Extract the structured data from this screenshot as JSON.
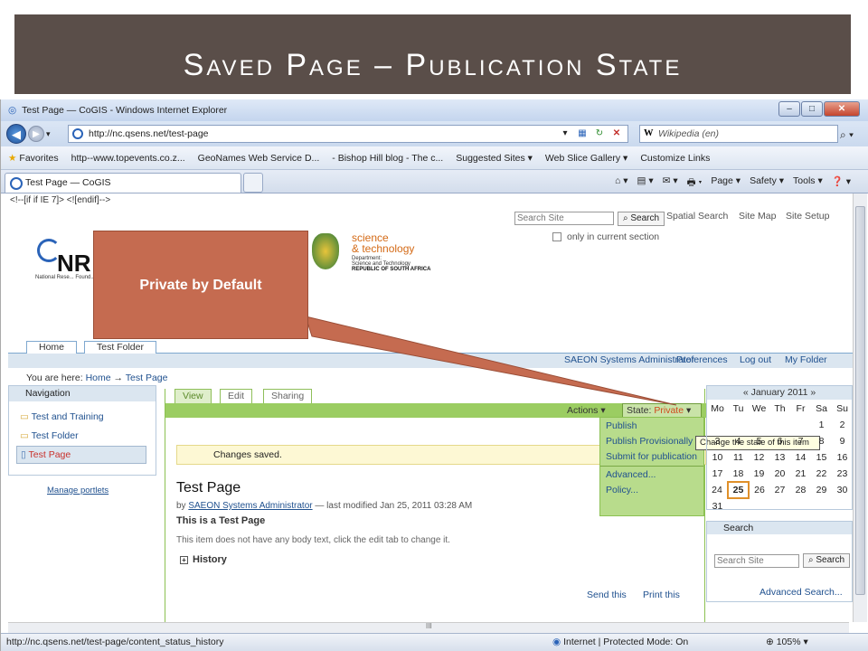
{
  "slide_title": "Saved Page – Publication State",
  "callout_text": "Private by Default",
  "browser": {
    "window_title": "Test Page — CoGIS - Windows Internet Explorer",
    "window_buttons": [
      "–",
      "□",
      "✕"
    ],
    "back_icon": "back-arrow-icon",
    "address": "http://nc.qsens.net/test-page",
    "search_engine_placeholder": "Wikipedia (en)",
    "search_engine_letter": "W",
    "favorites": [
      "Favorites",
      "http--www.topevents.co.z...",
      "GeoNames Web Service D...",
      "- Bishop Hill blog - The c...",
      "Suggested Sites ▾",
      "Web Slice Gallery ▾",
      "Customize Links"
    ],
    "tab_label": "Test Page — CoGIS",
    "commands": [
      "⌂ ▾",
      "▤ ▾",
      "✉ ▾",
      "🖶 ▾",
      "Page ▾",
      "Safety ▾",
      "Tools ▾",
      "❓ ▾"
    ],
    "status_url": "http://nc.qsens.net/test-page/content_status_history",
    "zone": "Internet | Protected Mode: On",
    "zoom": "105%",
    "hscroll_grip": "III"
  },
  "site": {
    "ie_comment": "<!--[if if IE 7]> <![endif]-->",
    "search_placeholder": "Search Site",
    "search_button": "Search",
    "top_links": [
      "Spatial Search",
      "Site Map",
      "Site Setup"
    ],
    "only_section": "only in current section",
    "logo_nrf_text": "NR",
    "logo_nrf_sub": "National Rese... Found...",
    "dst_logo_line1": "science",
    "dst_logo_line2": "& technology",
    "dst_logo_dept": "Department:",
    "dst_logo_dept2": "Science and Technology",
    "dst_logo_country": "REPUBLIC OF SOUTH AFRICA",
    "portal_tabs": [
      "Home",
      "Test Folder"
    ],
    "user_links": [
      "SAEON Systems Administrator",
      "Preferences",
      "Log out",
      "My Folder"
    ],
    "breadcrumb_prefix": "You are here:",
    "breadcrumb": [
      "Home",
      "→",
      "Test Page"
    ],
    "navigation_title": "Navigation",
    "nav_items": [
      "Test and Training",
      "Test Folder",
      "Test Page"
    ],
    "manage_portlets": "Manage portlets",
    "content_tabs": [
      "View",
      "Edit",
      "Sharing"
    ],
    "actions_label": "Actions ▾",
    "state_label": "State:",
    "state_value": "Private",
    "state_menu": [
      "Publish",
      "Publish Provisionally",
      "Submit for publication",
      "Advanced...",
      "Policy..."
    ],
    "tooltip": "Change the state of this item",
    "status_message": "Changes saved.",
    "page_heading": "Test Page",
    "byline_prefix": "by",
    "byline_author": "SAEON Systems Administrator",
    "byline_suffix": "— last modified Jan 25, 2011 03:28 AM",
    "description": "This is a Test Page",
    "no_body_text": "This item does not have any body text, click the edit tab to change it.",
    "history_label": "History",
    "footer_links": [
      "Send this",
      "Print this"
    ],
    "calendar_title": "« January 2011 »",
    "calendar_days": [
      "Mo",
      "Tu",
      "We",
      "Th",
      "Fr",
      "Sa",
      "Su"
    ],
    "calendar_weeks": [
      [
        "",
        "",
        "",
        "",
        "",
        "1",
        "2"
      ],
      [
        "3",
        "4",
        "5",
        "6",
        "7",
        "8",
        "9"
      ],
      [
        "10",
        "11",
        "12",
        "13",
        "14",
        "15",
        "16"
      ],
      [
        "17",
        "18",
        "19",
        "20",
        "21",
        "22",
        "23"
      ],
      [
        "24",
        "25",
        "26",
        "27",
        "28",
        "29",
        "30"
      ],
      [
        "31",
        "",
        "",
        "",
        "",
        "",
        ""
      ]
    ],
    "calendar_today": "25",
    "search_portlet_title": "Search",
    "search_portlet_placeholder": "Search Site",
    "search_portlet_button": "Search",
    "advanced_search": "Advanced Search..."
  },
  "colors": {
    "title_bg": "#5a4e49",
    "callout": "#c56b50",
    "plone_green": "#8cc152",
    "state_private": "#d0491d"
  }
}
